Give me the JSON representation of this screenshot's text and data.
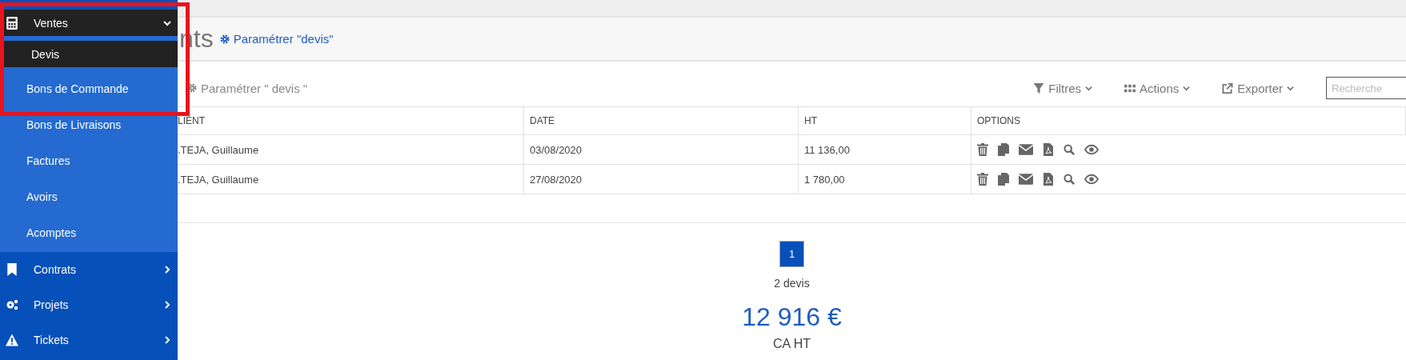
{
  "sidebar": {
    "items": [
      {
        "label": "Ventes",
        "kind": "calculator",
        "expanded": true,
        "children": [
          {
            "label": "Devis",
            "selected": true
          },
          {
            "label": "Bons de Commande",
            "selected": false
          },
          {
            "label": "Bons de Livraisons",
            "selected": false
          },
          {
            "label": "Factures",
            "selected": false
          },
          {
            "label": "Avoirs",
            "selected": false
          },
          {
            "label": "Acomptes",
            "selected": false
          }
        ]
      },
      {
        "label": "Contrats",
        "kind": "bookmark",
        "expanded": false
      },
      {
        "label": "Projets",
        "kind": "gears",
        "expanded": false
      },
      {
        "label": "Tickets",
        "kind": "warning",
        "expanded": false
      }
    ]
  },
  "header": {
    "title": "nts",
    "settings_link": "Paramétrer \"devis\""
  },
  "toolbar": {
    "settings_link": "Paramétrer \" devis \"",
    "filters": "Filtres",
    "actions": "Actions",
    "export": "Exporter",
    "search": {
      "placeholder": "Recherche"
    }
  },
  "table": {
    "columns": [
      "LIENT",
      "DATE",
      "HT",
      "OPTIONS"
    ],
    "rows": [
      {
        "client": ".TEJA, Guillaume",
        "date": "03/08/2020",
        "ht": "11 136,00"
      },
      {
        "client": ".TEJA, Guillaume",
        "date": "27/08/2020",
        "ht": "1 780,00"
      }
    ]
  },
  "pagination": {
    "pages": [
      {
        "label": "1",
        "selected": true
      }
    ]
  },
  "summary": {
    "count": "2 devis",
    "total": "12 916 €",
    "total_label": "CA HT"
  }
}
